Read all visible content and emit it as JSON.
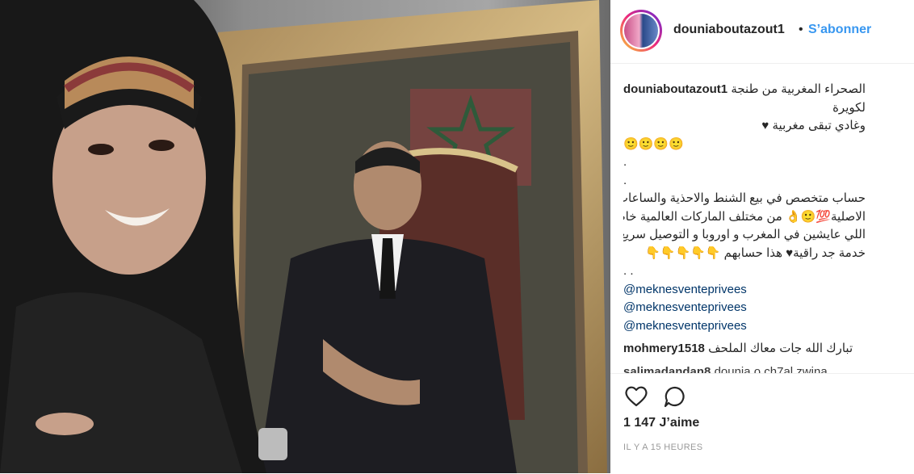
{
  "post": {
    "username": "douniaboutazout1",
    "separator": "•",
    "follow_label": "S’abonner"
  },
  "caption": {
    "username": "douniaboutazout1",
    "lines": [
      "الصحراء المغربية من طنجة",
      "لكويرة",
      "وغادي تبقى مغربية ♥",
      "🙂🙂🙂🙂",
      ".",
      ".",
      "حساب متخصص في بيع الشنط والاحذية والساعات",
      "الاصلية💯🙂👌 من مختلف الماركات العالمية خاصة للناس",
      "اللي عايشين في المغرب و اوروبا و التوصيل سريع مع",
      "خدمة جد راقية♥ هذا حسابهم 👇👇👇👇👇",
      ". ."
    ],
    "mentions": [
      "@meknesventeprivees",
      "@meknesventeprivees",
      "@meknesventeprivees"
    ]
  },
  "comments": [
    {
      "username": "mohmery1518",
      "text": "تبارك الله جات معاك الملحف"
    },
    {
      "username": "salimadandan8",
      "text": "dounia o ch7al zwina"
    }
  ],
  "actions": {
    "like_icon": "heart-outline-icon",
    "comment_icon": "comment-bubble-icon",
    "likes_text": "1 147 J’aime",
    "timestamp": "IL Y A 15 HEURES"
  },
  "colors": {
    "link_blue": "#3897f0",
    "mention_blue": "#003569",
    "text": "#262626",
    "muted": "#999999",
    "divider": "#efefef"
  }
}
